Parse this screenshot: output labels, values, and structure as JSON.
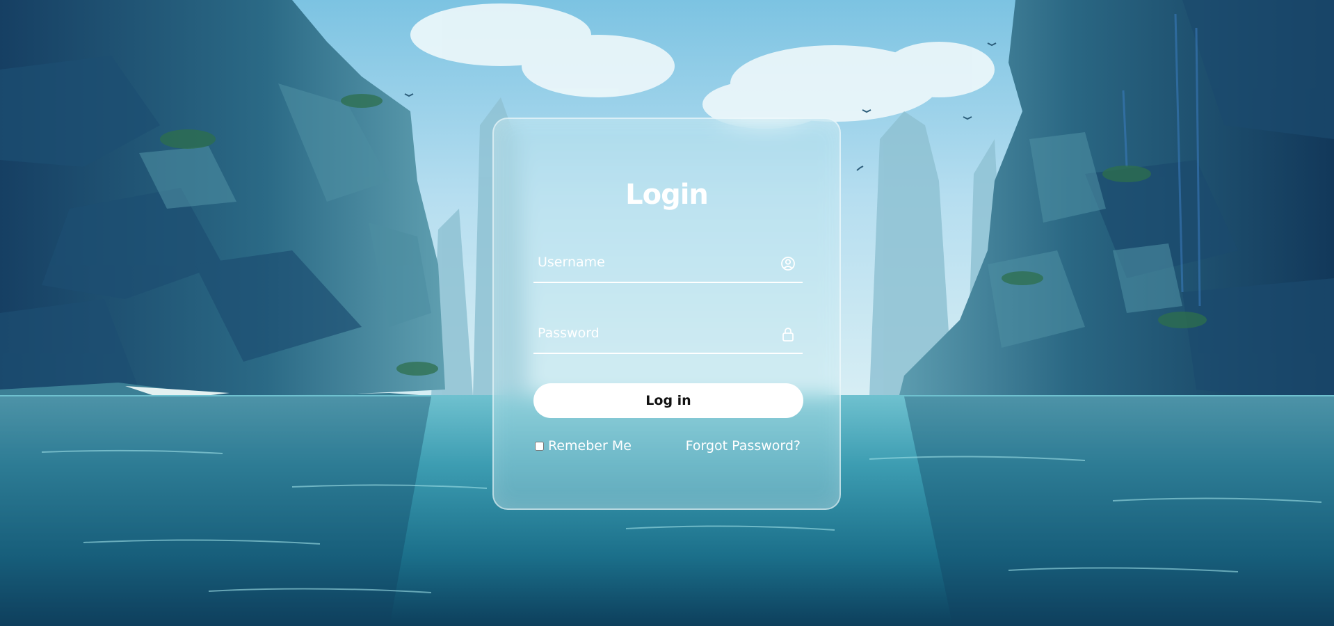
{
  "login": {
    "title": "Login",
    "username_placeholder": "Username",
    "password_placeholder": "Password",
    "username_icon": "user-circle-icon",
    "password_icon": "lock-icon",
    "submit_label": "Log in",
    "remember_label": "Remeber Me",
    "remember_checked": false,
    "forgot_label": "Forgot Password?"
  },
  "colors": {
    "card_border": "#ffffff",
    "button_bg": "#ffffff",
    "button_text": "#111111",
    "text": "#ffffff"
  }
}
